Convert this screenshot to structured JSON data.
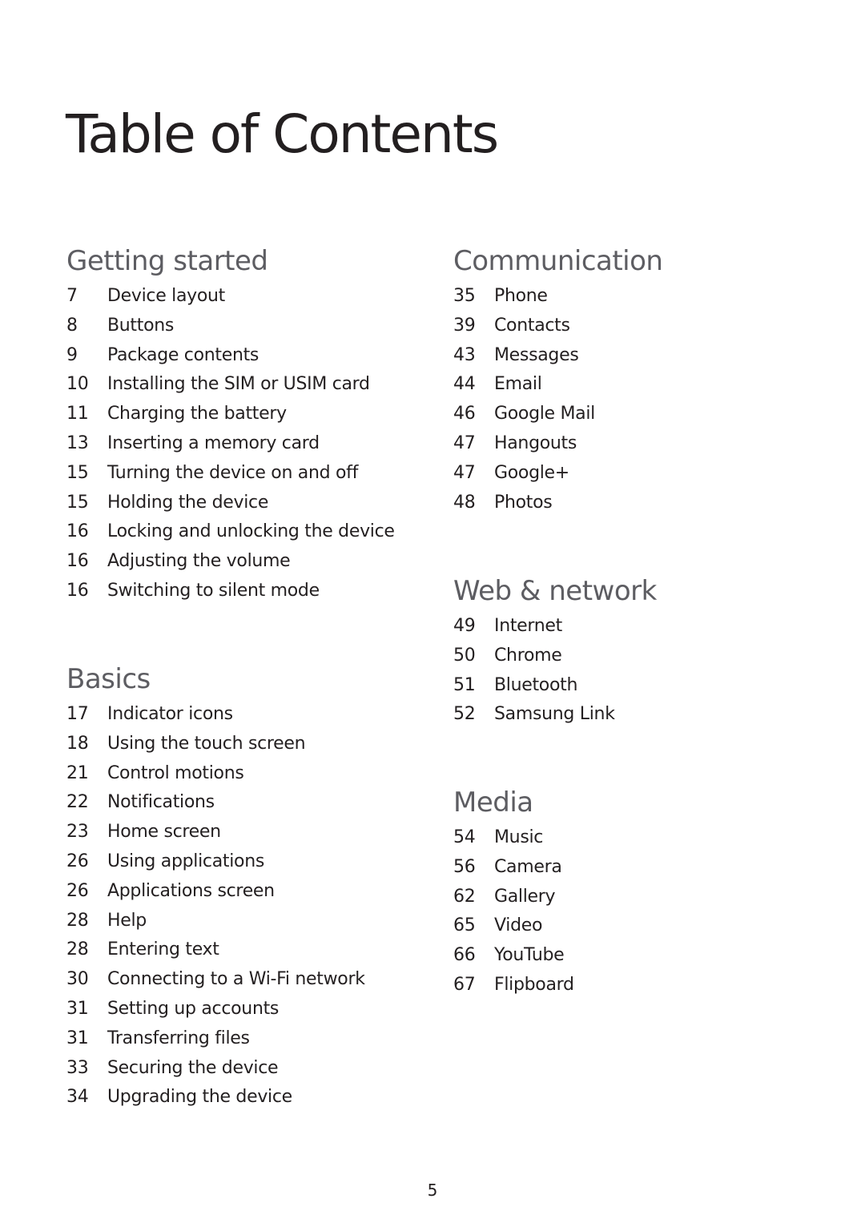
{
  "title": "Table of Contents",
  "sections": [
    {
      "heading": "Getting started",
      "items": [
        {
          "page": "7",
          "label": "Device layout"
        },
        {
          "page": "8",
          "label": "Buttons"
        },
        {
          "page": "9",
          "label": "Package contents"
        },
        {
          "page": "10",
          "label": "Installing the SIM or USIM card"
        },
        {
          "page": "11",
          "label": "Charging the battery"
        },
        {
          "page": "13",
          "label": "Inserting a memory card"
        },
        {
          "page": "15",
          "label": "Turning the device on and off"
        },
        {
          "page": "15",
          "label": "Holding the device"
        },
        {
          "page": "16",
          "label": "Locking and unlocking the device"
        },
        {
          "page": "16",
          "label": "Adjusting the volume"
        },
        {
          "page": "16",
          "label": "Switching to silent mode"
        }
      ]
    },
    {
      "heading": "Basics",
      "items": [
        {
          "page": "17",
          "label": "Indicator icons"
        },
        {
          "page": "18",
          "label": "Using the touch screen"
        },
        {
          "page": "21",
          "label": "Control motions"
        },
        {
          "page": "22",
          "label": "Notifications"
        },
        {
          "page": "23",
          "label": "Home screen"
        },
        {
          "page": "26",
          "label": "Using applications"
        },
        {
          "page": "26",
          "label": "Applications screen"
        },
        {
          "page": "28",
          "label": "Help"
        },
        {
          "page": "28",
          "label": "Entering text"
        },
        {
          "page": "30",
          "label": "Connecting to a Wi-Fi network"
        },
        {
          "page": "31",
          "label": "Setting up accounts"
        },
        {
          "page": "31",
          "label": "Transferring files"
        },
        {
          "page": "33",
          "label": "Securing the device"
        },
        {
          "page": "34",
          "label": "Upgrading the device"
        }
      ]
    },
    {
      "heading": "Communication",
      "items": [
        {
          "page": "35",
          "label": "Phone"
        },
        {
          "page": "39",
          "label": "Contacts"
        },
        {
          "page": "43",
          "label": "Messages"
        },
        {
          "page": "44",
          "label": "Email"
        },
        {
          "page": "46",
          "label": "Google Mail"
        },
        {
          "page": "47",
          "label": "Hangouts"
        },
        {
          "page": "47",
          "label": "Google+"
        },
        {
          "page": "48",
          "label": "Photos"
        }
      ]
    },
    {
      "heading": "Web & network",
      "items": [
        {
          "page": "49",
          "label": "Internet"
        },
        {
          "page": "50",
          "label": "Chrome"
        },
        {
          "page": "51",
          "label": "Bluetooth"
        },
        {
          "page": "52",
          "label": "Samsung Link"
        }
      ]
    },
    {
      "heading": "Media",
      "items": [
        {
          "page": "54",
          "label": "Music"
        },
        {
          "page": "56",
          "label": "Camera"
        },
        {
          "page": "62",
          "label": "Gallery"
        },
        {
          "page": "65",
          "label": "Video"
        },
        {
          "page": "66",
          "label": "YouTube"
        },
        {
          "page": "67",
          "label": "Flipboard"
        }
      ]
    }
  ],
  "page_number": "5"
}
